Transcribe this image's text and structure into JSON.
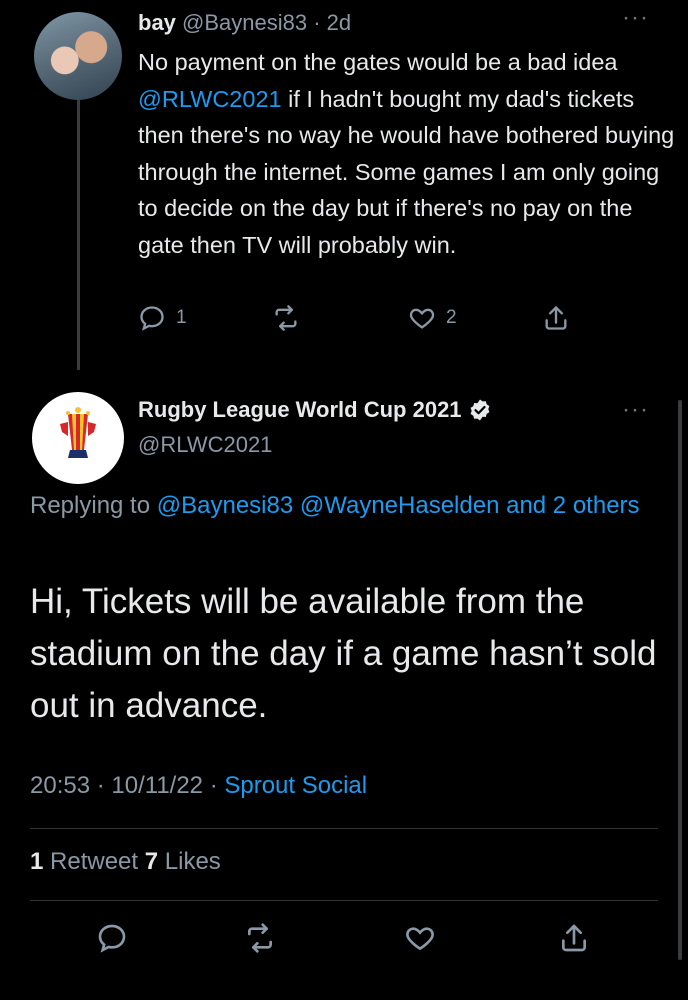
{
  "reply_tweet": {
    "display_name": "bay",
    "handle_time": "@Baynesi83 · 2d",
    "text_before_mention": "No payment on the gates would be a bad idea ",
    "mention": "@RLWC2021",
    "text_after_mention": " if I hadn't bought my dad's tickets then there's no way he would have bothered buying through the internet. Some games I am only going to decide on the day but if there's no pay on the gate then TV will probably win.",
    "reply_count": "1",
    "like_count": "2",
    "menu_icon": "more-horizontal-icon"
  },
  "main_tweet": {
    "display_name": "Rugby League World Cup 2021",
    "handle": "@RLWC2021",
    "replying_prefix": "Replying to ",
    "replying_users": "@Baynesi83 @WayneHaselden and 2 others",
    "text": "Hi, Tickets will be available from the stadium on the day if a game hasn’t sold out in advance.",
    "time_date": "20:53 · 10/11/22 · ",
    "source": "Sprout Social",
    "retweet_count": "1",
    "retweet_label": " Retweet ",
    "like_count": "7",
    "like_label": " Likes",
    "verified_icon": "verified-badge-icon"
  },
  "colors": {
    "background": "#000000",
    "text": "#e7e9ea",
    "muted": "#8b98a5",
    "link": "#1d9bf0",
    "divider": "#2f3336"
  }
}
